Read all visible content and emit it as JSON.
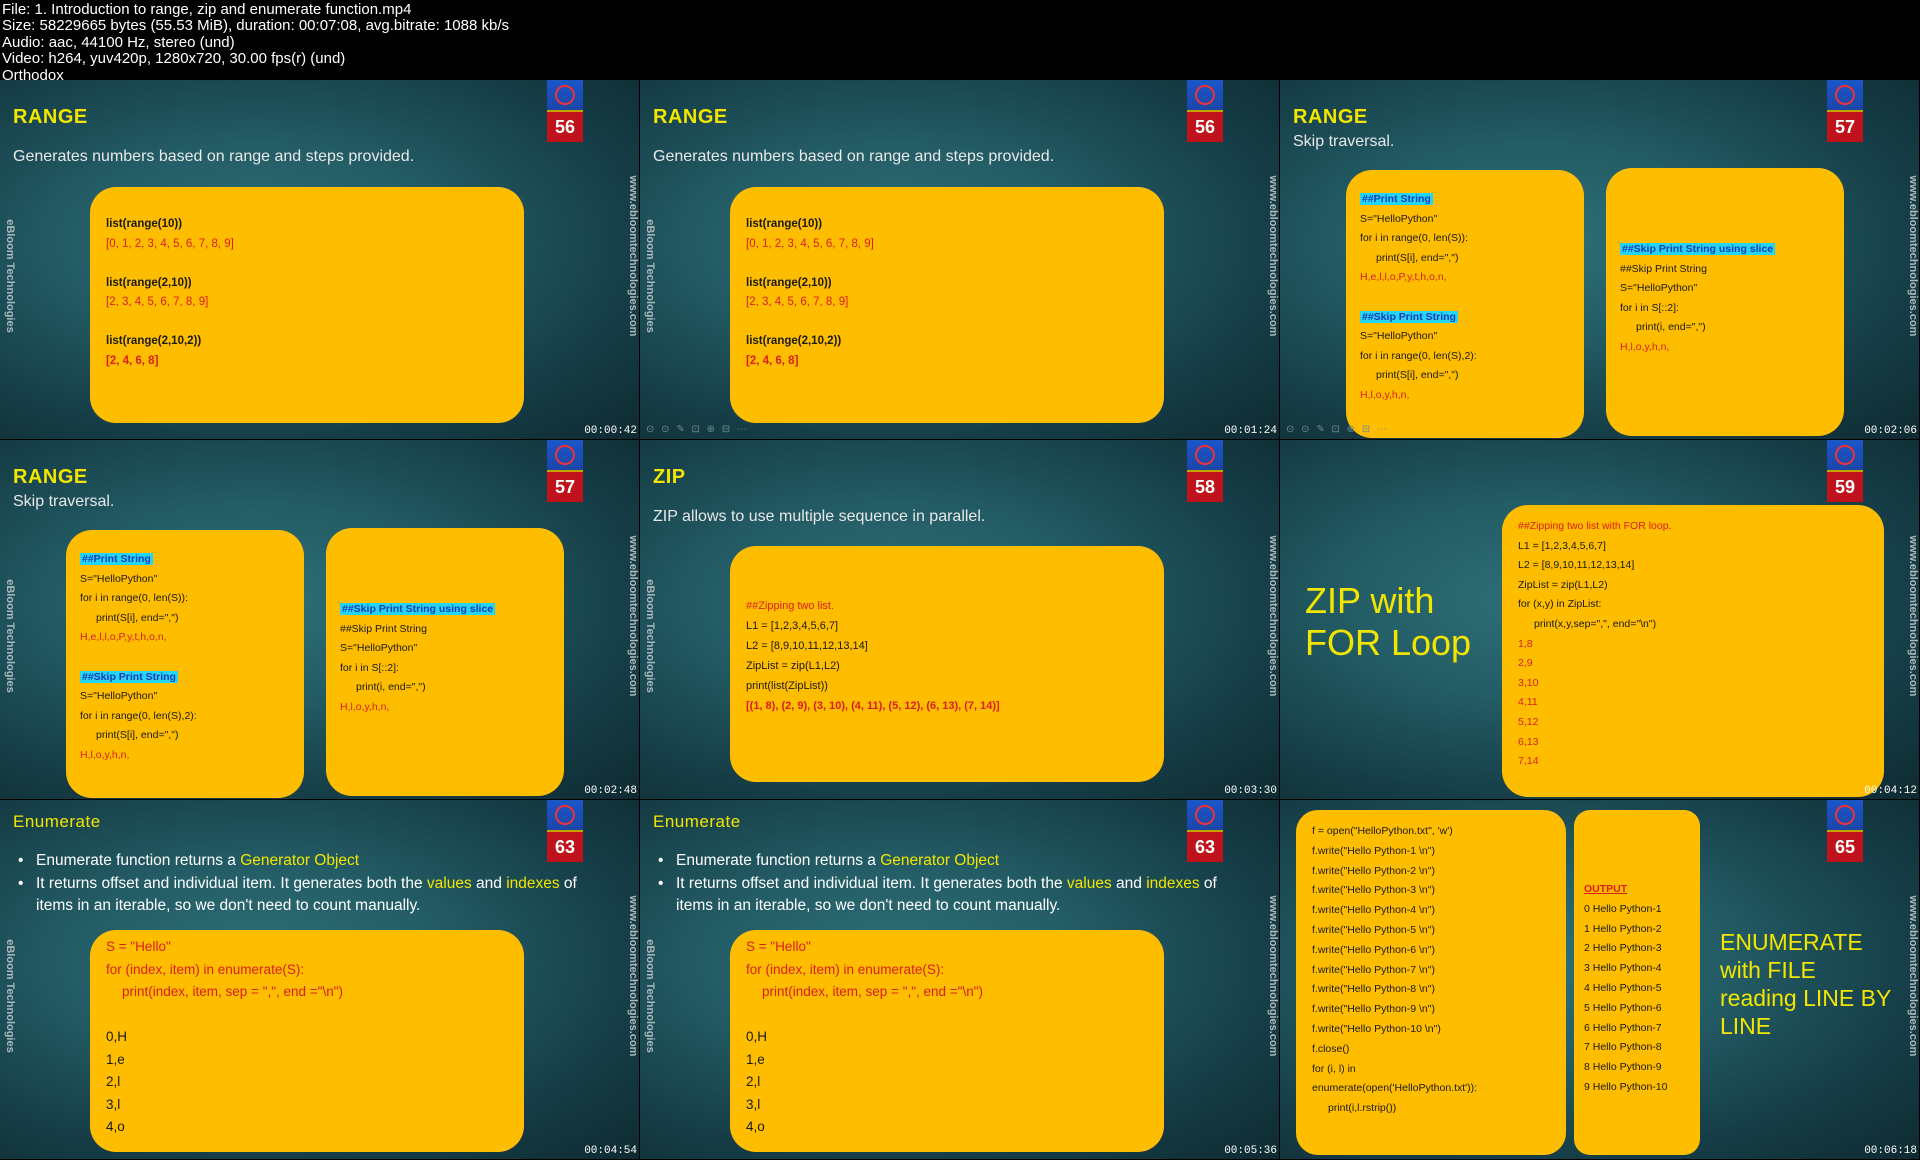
{
  "header": {
    "file": "File: 1. Introduction to range, zip and enumerate function.mp4",
    "size": "Size: 58229665 bytes (55.53 MiB), duration: 00:07:08, avg.bitrate: 1088 kb/s",
    "audio": "Audio: aac, 44100 Hz, stereo (und)",
    "video": "Video: h264, yuv420p, 1280x720, 30.00 fps(r) (und)",
    "watermark": "Orthodox"
  },
  "brand": {
    "side_left": "eBloom Technologies",
    "side_right": "www.ebloomtechnologies.com",
    "controls": "⊙ ⊙ ✎ ⊡ ⊕ ⊟ ⋯"
  },
  "tiles": [
    {
      "title": "RANGE",
      "slide": "56",
      "timestamp": "00:00:42",
      "subtitle": "Generates numbers based on range and steps provided.",
      "code": [
        "list(range(10))",
        "[0, 1, 2, 3, 4, 5, 6, 7, 8, 9]",
        "",
        "list(range(2,10))",
        "[2, 3, 4, 5, 6, 7, 8, 9]",
        "",
        "list(range(2,10,2))",
        "[2, 4, 6, 8]"
      ]
    },
    {
      "title": "RANGE",
      "slide": "56",
      "timestamp": "00:01:24",
      "subtitle": "Generates numbers based on range and steps provided.",
      "code": [
        "list(range(10))",
        "[0, 1, 2, 3, 4, 5, 6, 7, 8, 9]",
        "",
        "list(range(2,10))",
        "[2, 3, 4, 5, 6, 7, 8, 9]",
        "",
        "list(range(2,10,2))",
        "[2, 4, 6, 8]"
      ]
    },
    {
      "title": "RANGE",
      "slide": "57",
      "timestamp": "00:02:06",
      "subtitle": "Skip traversal.",
      "left": [
        "##Print String",
        "S=\"HelloPython\"",
        "for i in range(0, len(S)):",
        "print(S[i], end=\",\")",
        "H,e,l,l,o,P,y,t,h,o,n,",
        "",
        "##Skip Print String",
        "S=\"HelloPython\"",
        "for i in range(0, len(S),2):",
        "print(S[i], end=\",\")",
        "H,l,o,y,h,n,"
      ],
      "right": [
        "##Skip Print String using slice",
        "##Skip Print String",
        "S=\"HelloPython\"",
        "for i in S[::2]:",
        "print(i, end=\",\")",
        "H,l,o,y,h,n,"
      ]
    },
    {
      "title": "RANGE",
      "slide": "57",
      "timestamp": "00:02:48",
      "subtitle": "Skip traversal.",
      "left": [
        "##Print String",
        "S=\"HelloPython\"",
        "for i in range(0, len(S)):",
        "print(S[i], end=\",\")",
        "H,e,l,l,o,P,y,t,h,o,n,",
        "",
        "##Skip Print String",
        "S=\"HelloPython\"",
        "for i in range(0, len(S),2):",
        "print(S[i], end=\",\")",
        "H,l,o,y,h,n,"
      ],
      "right": [
        "##Skip Print String using slice",
        "##Skip Print String",
        "S=\"HelloPython\"",
        "for i in S[::2]:",
        "print(i, end=\",\")",
        "H,l,o,y,h,n,"
      ]
    },
    {
      "title": "ZIP",
      "slide": "58",
      "timestamp": "00:03:30",
      "subtitle": "ZIP allows to use multiple sequence in parallel.",
      "code": [
        "##Zipping two list.",
        "L1 = [1,2,3,4,5,6,7]",
        "L2 = [8,9,10,11,12,13,14]",
        "ZipList = zip(L1,L2)",
        "print(list(ZipList))",
        "[(1, 8), (2, 9), (3, 10), (4, 11), (5, 12), (6, 13), (7, 14)]"
      ]
    },
    {
      "bigtitle1": "ZIP with",
      "bigtitle2": "FOR Loop",
      "slide": "59",
      "timestamp": "00:04:12",
      "code": [
        "##Zipping two list with FOR loop.",
        "L1 = [1,2,3,4,5,6,7]",
        "L2 = [8,9,10,11,12,13,14]",
        "ZipList = zip(L1,L2)",
        "for (x,y) in ZipList:",
        "print(x,y,sep=\",\", end=\"\\n\")",
        "1,8",
        "2,9",
        "3,10",
        "4,11",
        "5,12",
        "6,13",
        "7,14"
      ]
    },
    {
      "title": "Enumerate",
      "slide": "63",
      "timestamp": "00:04:54",
      "b1_pre": "Enumerate function returns a ",
      "b1_hl": "Generator Object",
      "b2_a": "It returns offset and individual item. It generates both the ",
      "b2_hl1": "values",
      "b2_b": " and ",
      "b2_hl2": "indexes",
      "b2_c": " of items in an iterable, so we don't need to count manually.",
      "code": [
        "S = \"Hello\"",
        "for (index, item) in enumerate(S):",
        "print(index, item, sep = \",\", end =\"\\n\")",
        "",
        "0,H",
        "1,e",
        "2,l",
        "3,l",
        "4,o"
      ]
    },
    {
      "title": "Enumerate",
      "slide": "63",
      "timestamp": "00:05:36",
      "b1_pre": "Enumerate function returns a ",
      "b1_hl": "Generator Object",
      "b2_a": "It returns offset and individual item. It generates both the ",
      "b2_hl1": "values",
      "b2_b": " and ",
      "b2_hl2": "indexes",
      "b2_c": " of items in an iterable, so we don't need to count manually.",
      "code": [
        "S = \"Hello\"",
        "for (index, item) in enumerate(S):",
        "print(index, item, sep = \",\", end =\"\\n\")",
        "",
        "0,H",
        "1,e",
        "2,l",
        "3,l",
        "4,o"
      ]
    },
    {
      "slide": "65",
      "timestamp": "00:06:18",
      "bigtitle": [
        "ENUMERATE",
        "with FILE",
        "reading LINE BY",
        "LINE"
      ],
      "code": [
        "f = open(\"HelloPython.txt\", 'w')",
        "f.write(\"Hello Python-1 \\n\")",
        "f.write(\"Hello Python-2 \\n\")",
        "f.write(\"Hello Python-3 \\n\")",
        "f.write(\"Hello Python-4 \\n\")",
        "f.write(\"Hello Python-5 \\n\")",
        "f.write(\"Hello Python-6 \\n\")",
        "f.write(\"Hello Python-7 \\n\")",
        "f.write(\"Hello Python-8 \\n\")",
        "f.write(\"Hello Python-9 \\n\")",
        "f.write(\"Hello Python-10 \\n\")",
        "f.close()",
        "for (i, l) in",
        "enumerate(open('HelloPython.txt')):",
        "print(i,l.rstrip())"
      ],
      "output_label": "OUTPUT",
      "output": [
        "0 Hello Python-1",
        "1 Hello Python-2",
        "2 Hello Python-3",
        "3 Hello Python-4",
        "4 Hello Python-5",
        "5 Hello Python-6",
        "6 Hello Python-7",
        "7 Hello Python-8",
        "8 Hello Python-9",
        "9 Hello Python-10"
      ]
    }
  ]
}
